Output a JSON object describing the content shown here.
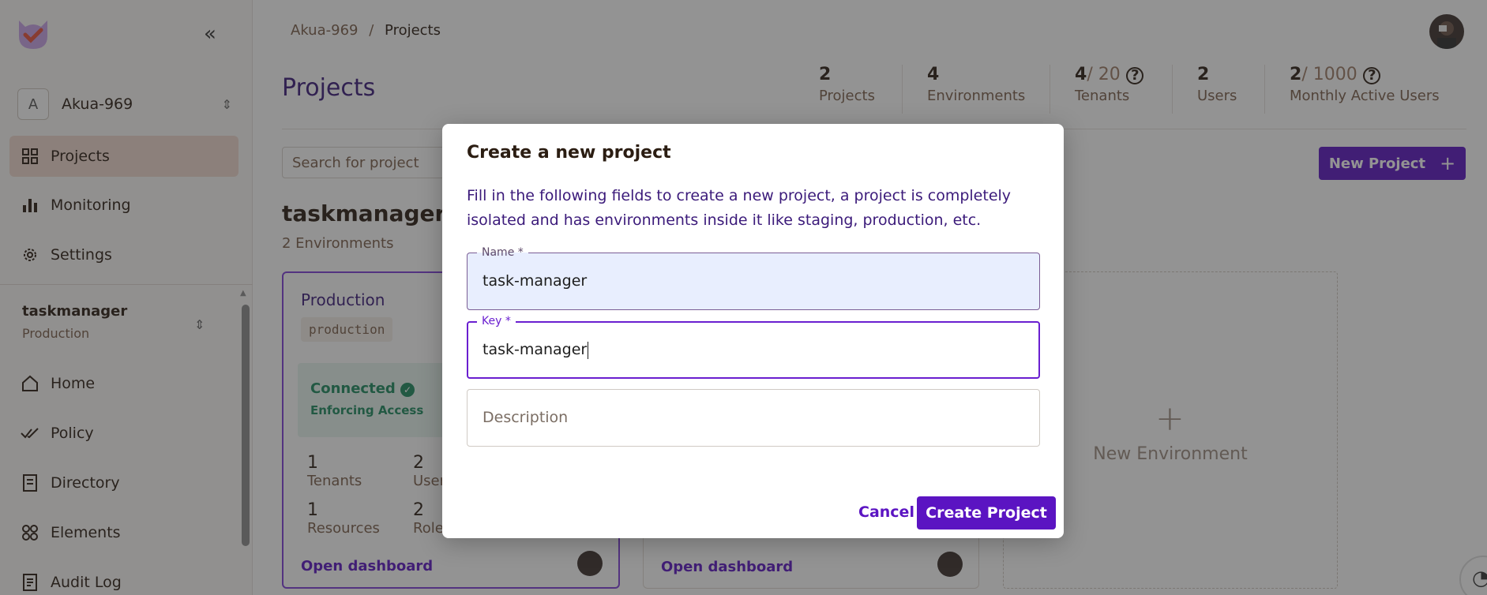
{
  "sidebar": {
    "org": {
      "initial": "A",
      "name": "Akua-969"
    },
    "items": [
      {
        "label": "Projects",
        "icon": "grid-icon"
      },
      {
        "label": "Monitoring",
        "icon": "bar-chart-icon"
      },
      {
        "label": "Settings",
        "icon": "gear-icon"
      }
    ],
    "env_select": {
      "project": "taskmanager",
      "environment": "Production"
    },
    "env_items": [
      {
        "label": "Home",
        "icon": "home-icon"
      },
      {
        "label": "Policy",
        "icon": "check-double-icon"
      },
      {
        "label": "Directory",
        "icon": "directory-icon"
      },
      {
        "label": "Elements",
        "icon": "elements-icon"
      },
      {
        "label": "Audit Log",
        "icon": "audit-log-icon"
      }
    ]
  },
  "breadcrumb": {
    "org": "Akua-969",
    "sep": "/",
    "current": "Projects"
  },
  "page": {
    "title": "Projects"
  },
  "stats": [
    {
      "value": "2",
      "limit": "",
      "label": "Projects"
    },
    {
      "value": "4",
      "limit": "",
      "label": "Environments"
    },
    {
      "value": "4",
      "limit": "/ 20",
      "label": "Tenants"
    },
    {
      "value": "2",
      "limit": "",
      "label": "Users"
    },
    {
      "value": "2",
      "limit": "/ 1000",
      "label": "Monthly Active Users"
    }
  ],
  "search": {
    "placeholder": "Search for project"
  },
  "new_project_label": "New Project",
  "project": {
    "name": "taskmanager",
    "env_count": "2 Environments"
  },
  "env_card": {
    "title": "Production",
    "key": "production",
    "status": "Connected",
    "enforcing": "Enforcing Access",
    "metrics": [
      {
        "value": "1",
        "label": "Tenants"
      },
      {
        "value": "2",
        "label": "Users"
      },
      {
        "value": "1",
        "label": "Resources"
      },
      {
        "value": "2",
        "label": "Roles"
      }
    ],
    "open_dashboard": "Open dashboard"
  },
  "env_card2": {
    "open_dashboard": "Open dashboard"
  },
  "new_environment": "New Environment",
  "modal": {
    "title": "Create a new project",
    "description": "Fill in the following fields to create a new project, a project is completely isolated and has environments inside it like staging, production, etc.",
    "name_label": "Name *",
    "name_value": "task-manager",
    "key_label": "Key *",
    "key_value": "task-manager",
    "description_placeholder": "Description",
    "cancel_label": "Cancel",
    "create_label": "Create Project"
  },
  "colors": {
    "accent": "#5b14c2",
    "sidebar_active": "#f1d9cf",
    "connected": "#1c8a5f"
  }
}
